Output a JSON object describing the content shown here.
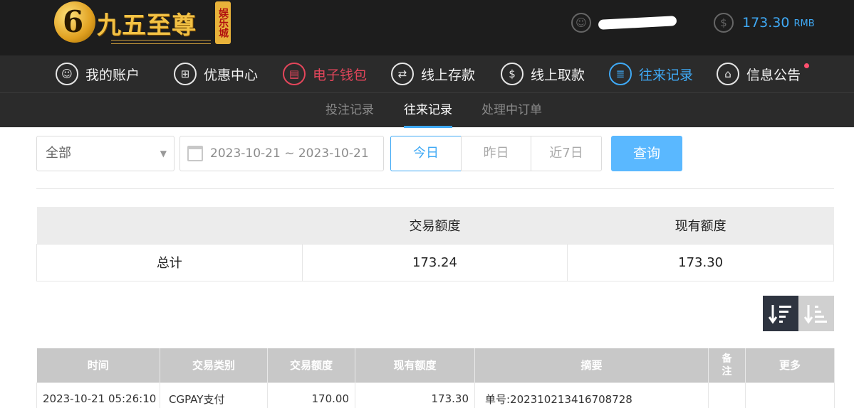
{
  "header": {
    "logo": {
      "mark": "6",
      "name": "九五至尊",
      "badge": "娱乐城"
    },
    "balance": {
      "value": "173.30",
      "currency": "RMB"
    }
  },
  "nav": [
    {
      "label": "我的账户",
      "icon": "user-icon",
      "glyph": "☺"
    },
    {
      "label": "优惠中心",
      "icon": "gift-icon",
      "glyph": "⊞"
    },
    {
      "label": "电子钱包",
      "icon": "wallet-icon",
      "glyph": "▤"
    },
    {
      "label": "线上存款",
      "icon": "deposit-icon",
      "glyph": "⇄"
    },
    {
      "label": "线上取款",
      "icon": "withdraw-icon",
      "glyph": "$"
    },
    {
      "label": "往来记录",
      "icon": "records-icon",
      "glyph": "≣"
    },
    {
      "label": "信息公告",
      "icon": "bell-icon",
      "glyph": "⌂"
    }
  ],
  "colors": {
    "active_nav": "#e4465b",
    "accent": "#3fa9f5"
  },
  "subnav": [
    {
      "label": "投注记录"
    },
    {
      "label": "往来记录"
    },
    {
      "label": "处理中订单"
    }
  ],
  "filters": {
    "type_select": "全部",
    "date_range": "2023-10-21 ~ 2023-10-21",
    "quick": [
      "今日",
      "昨日",
      "近7日"
    ],
    "query_label": "查询"
  },
  "summary": {
    "headers": [
      "",
      "交易额度",
      "现有额度"
    ],
    "row": {
      "label": "总计",
      "amount": "173.24",
      "balance": "173.30"
    }
  },
  "records": {
    "headers": [
      "时间",
      "交易类别",
      "交易额度",
      "现有额度",
      "摘要",
      "备注",
      "更多"
    ],
    "rows": [
      {
        "time": "2023-10-21 05:26:10",
        "type": "CGPAY支付",
        "amount": "170.00",
        "balance": "173.30",
        "summary": "单号:202310213416708728",
        "note": "",
        "more": ""
      }
    ]
  }
}
